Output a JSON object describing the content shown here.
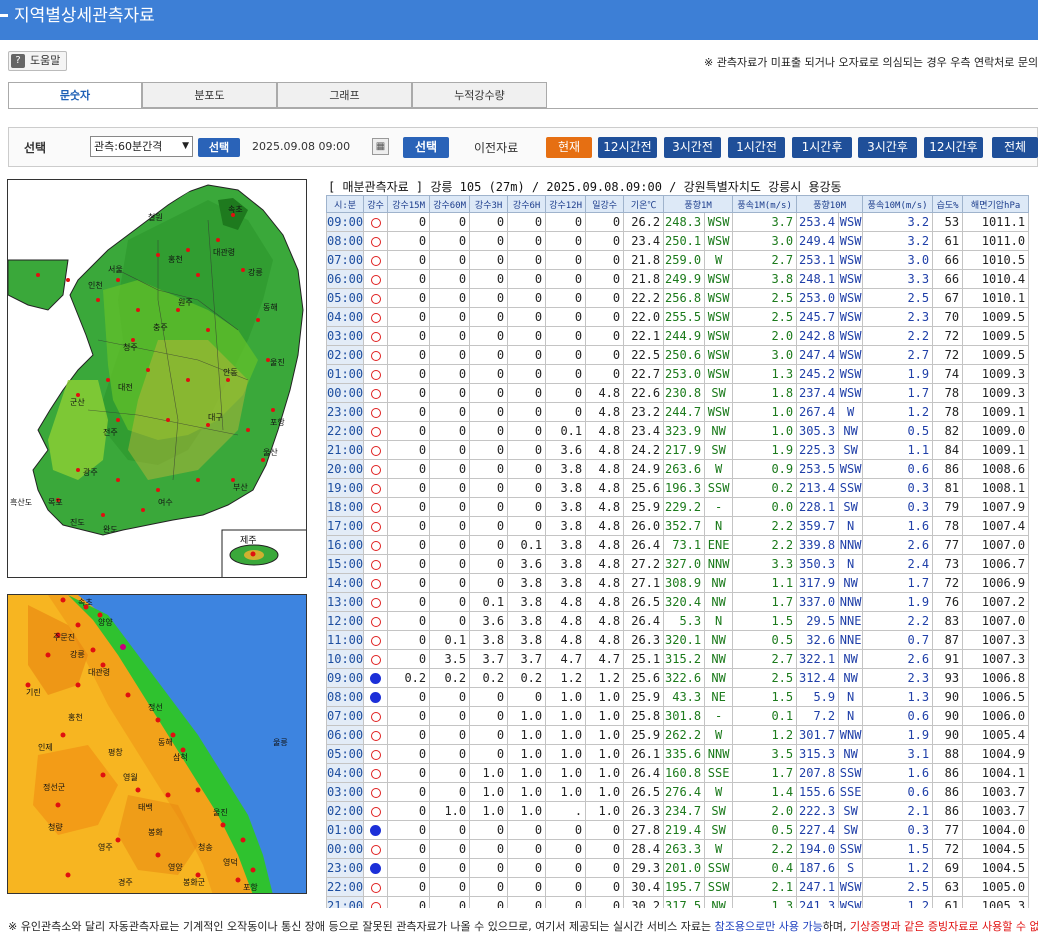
{
  "title": "지역별상세관측자료",
  "help_label": "도움말",
  "notice": "※ 관측자료가 미표출 되거나 오자료로 의심되는 경우 우측 연락처로 문의",
  "tabs": [
    "문숫자",
    "분포도",
    "그래프",
    "누적강수량"
  ],
  "selector": {
    "label": "선택",
    "interval": "관측:60분간격",
    "select_btn": "선택",
    "datetime": "2025.09.08 09:00",
    "select_btn2": "선택",
    "prev_label": "이전자료",
    "nav": [
      "현재",
      "12시간전",
      "3시간전",
      "1시간전",
      "1시간후",
      "3시간후",
      "12시간후",
      "전체"
    ]
  },
  "heading": "[ 매분관측자료 ] 강릉 105 (27m) / 2025.09.08.09:00 / 강원특별자치도 강릉시 용강동",
  "columns": [
    "시:분",
    "강수",
    "강수15M",
    "강수60M",
    "강수3H",
    "강수6H",
    "강수12H",
    "일강수",
    "기온℃",
    "풍향1M",
    "",
    "풍속1M(m/s)",
    "풍향10M",
    "",
    "풍속10M(m/s)",
    "습도%",
    "해면기압hPa"
  ],
  "rows": [
    [
      "09:00",
      "o",
      "0",
      "0",
      "0",
      "0",
      "0",
      "0",
      "26.2",
      "248.3",
      "WSW",
      "3.7",
      "253.4",
      "WSW",
      "3.2",
      "53",
      "1011.1"
    ],
    [
      "08:00",
      "o",
      "0",
      "0",
      "0",
      "0",
      "0",
      "0",
      "23.4",
      "250.1",
      "WSW",
      "3.0",
      "249.4",
      "WSW",
      "3.2",
      "61",
      "1011.0"
    ],
    [
      "07:00",
      "o",
      "0",
      "0",
      "0",
      "0",
      "0",
      "0",
      "21.8",
      "259.0",
      "W",
      "2.7",
      "253.1",
      "WSW",
      "3.0",
      "66",
      "1010.5"
    ],
    [
      "06:00",
      "o",
      "0",
      "0",
      "0",
      "0",
      "0",
      "0",
      "21.8",
      "249.9",
      "WSW",
      "3.8",
      "248.1",
      "WSW",
      "3.3",
      "66",
      "1010.4"
    ],
    [
      "05:00",
      "o",
      "0",
      "0",
      "0",
      "0",
      "0",
      "0",
      "22.2",
      "256.8",
      "WSW",
      "2.5",
      "253.0",
      "WSW",
      "2.5",
      "67",
      "1010.1"
    ],
    [
      "04:00",
      "o",
      "0",
      "0",
      "0",
      "0",
      "0",
      "0",
      "22.0",
      "255.5",
      "WSW",
      "2.5",
      "245.7",
      "WSW",
      "2.3",
      "70",
      "1009.5"
    ],
    [
      "03:00",
      "o",
      "0",
      "0",
      "0",
      "0",
      "0",
      "0",
      "22.1",
      "244.9",
      "WSW",
      "2.0",
      "242.8",
      "WSW",
      "2.2",
      "72",
      "1009.5"
    ],
    [
      "02:00",
      "o",
      "0",
      "0",
      "0",
      "0",
      "0",
      "0",
      "22.5",
      "250.6",
      "WSW",
      "3.0",
      "247.4",
      "WSW",
      "2.7",
      "72",
      "1009.5"
    ],
    [
      "01:00",
      "o",
      "0",
      "0",
      "0",
      "0",
      "0",
      "0",
      "22.7",
      "253.0",
      "WSW",
      "1.3",
      "245.2",
      "WSW",
      "1.9",
      "74",
      "1009.3"
    ],
    [
      "00:00",
      "o",
      "0",
      "0",
      "0",
      "0",
      "0",
      "4.8",
      "22.6",
      "230.8",
      "SW",
      "1.8",
      "237.4",
      "WSW",
      "1.7",
      "78",
      "1009.3"
    ],
    [
      "23:00",
      "o",
      "0",
      "0",
      "0",
      "0",
      "0",
      "4.8",
      "23.2",
      "244.7",
      "WSW",
      "1.0",
      "267.4",
      "W",
      "1.2",
      "78",
      "1009.1"
    ],
    [
      "22:00",
      "o",
      "0",
      "0",
      "0",
      "0",
      "0.1",
      "4.8",
      "23.4",
      "323.9",
      "NW",
      "1.0",
      "305.3",
      "NW",
      "0.5",
      "82",
      "1009.0"
    ],
    [
      "21:00",
      "o",
      "0",
      "0",
      "0",
      "0",
      "3.6",
      "4.8",
      "24.2",
      "217.9",
      "SW",
      "1.9",
      "225.3",
      "SW",
      "1.1",
      "84",
      "1009.1"
    ],
    [
      "20:00",
      "o",
      "0",
      "0",
      "0",
      "0",
      "3.8",
      "4.8",
      "24.9",
      "263.6",
      "W",
      "0.9",
      "253.5",
      "WSW",
      "0.6",
      "86",
      "1008.6"
    ],
    [
      "19:00",
      "o",
      "0",
      "0",
      "0",
      "0",
      "3.8",
      "4.8",
      "25.6",
      "196.3",
      "SSW",
      "0.2",
      "213.4",
      "SSW",
      "0.3",
      "81",
      "1008.1"
    ],
    [
      "18:00",
      "o",
      "0",
      "0",
      "0",
      "0",
      "3.8",
      "4.8",
      "25.9",
      "229.2",
      "-",
      "0.0",
      "228.1",
      "SW",
      "0.3",
      "79",
      "1007.9"
    ],
    [
      "17:00",
      "o",
      "0",
      "0",
      "0",
      "0",
      "3.8",
      "4.8",
      "26.0",
      "352.7",
      "N",
      "2.2",
      "359.7",
      "N",
      "1.6",
      "78",
      "1007.4"
    ],
    [
      "16:00",
      "o",
      "0",
      "0",
      "0",
      "0.1",
      "3.8",
      "4.8",
      "26.4",
      "73.1",
      "ENE",
      "2.2",
      "339.8",
      "NNW",
      "2.6",
      "77",
      "1007.0"
    ],
    [
      "15:00",
      "o",
      "0",
      "0",
      "0",
      "3.6",
      "3.8",
      "4.8",
      "27.2",
      "327.0",
      "NNW",
      "3.3",
      "350.3",
      "N",
      "2.4",
      "73",
      "1006.7"
    ],
    [
      "14:00",
      "o",
      "0",
      "0",
      "0",
      "3.8",
      "3.8",
      "4.8",
      "27.1",
      "308.9",
      "NW",
      "1.1",
      "317.9",
      "NW",
      "1.7",
      "72",
      "1006.9"
    ],
    [
      "13:00",
      "o",
      "0",
      "0",
      "0.1",
      "3.8",
      "4.8",
      "4.8",
      "26.5",
      "320.4",
      "NW",
      "1.7",
      "337.0",
      "NNW",
      "1.9",
      "76",
      "1007.2"
    ],
    [
      "12:00",
      "o",
      "0",
      "0",
      "3.6",
      "3.8",
      "4.8",
      "4.8",
      "26.4",
      "5.3",
      "N",
      "1.5",
      "29.5",
      "NNE",
      "2.2",
      "83",
      "1007.0"
    ],
    [
      "11:00",
      "o",
      "0",
      "0.1",
      "3.8",
      "3.8",
      "4.8",
      "4.8",
      "26.3",
      "320.1",
      "NW",
      "0.5",
      "32.6",
      "NNE",
      "0.7",
      "87",
      "1007.3"
    ],
    [
      "10:00",
      "o",
      "0",
      "3.5",
      "3.7",
      "3.7",
      "4.7",
      "4.7",
      "25.1",
      "315.2",
      "NW",
      "2.7",
      "322.1",
      "NW",
      "2.6",
      "91",
      "1007.3"
    ],
    [
      "09:00",
      "f",
      "0.2",
      "0.2",
      "0.2",
      "0.2",
      "1.2",
      "1.2",
      "25.6",
      "322.6",
      "NW",
      "2.5",
      "312.4",
      "NW",
      "2.3",
      "93",
      "1006.8"
    ],
    [
      "08:00",
      "f",
      "0",
      "0",
      "0",
      "0",
      "1.0",
      "1.0",
      "25.9",
      "43.3",
      "NE",
      "1.5",
      "5.9",
      "N",
      "1.3",
      "90",
      "1006.5"
    ],
    [
      "07:00",
      "o",
      "0",
      "0",
      "0",
      "1.0",
      "1.0",
      "1.0",
      "25.8",
      "301.8",
      "-",
      "0.1",
      "7.2",
      "N",
      "0.6",
      "90",
      "1006.0"
    ],
    [
      "06:00",
      "o",
      "0",
      "0",
      "0",
      "1.0",
      "1.0",
      "1.0",
      "25.9",
      "262.2",
      "W",
      "1.2",
      "301.7",
      "WNW",
      "1.9",
      "90",
      "1005.4"
    ],
    [
      "05:00",
      "o",
      "0",
      "0",
      "0",
      "1.0",
      "1.0",
      "1.0",
      "26.1",
      "335.6",
      "NNW",
      "3.5",
      "315.3",
      "NW",
      "3.1",
      "88",
      "1004.9"
    ],
    [
      "04:00",
      "o",
      "0",
      "0",
      "1.0",
      "1.0",
      "1.0",
      "1.0",
      "26.4",
      "160.8",
      "SSE",
      "1.7",
      "207.8",
      "SSW",
      "1.6",
      "86",
      "1004.1"
    ],
    [
      "03:00",
      "o",
      "0",
      "0",
      "1.0",
      "1.0",
      "1.0",
      "1.0",
      "26.5",
      "276.4",
      "W",
      "1.4",
      "155.6",
      "SSE",
      "0.6",
      "86",
      "1003.7"
    ],
    [
      "02:00",
      "o",
      "0",
      "1.0",
      "1.0",
      "1.0",
      ".",
      "1.0",
      "26.3",
      "234.7",
      "SW",
      "2.0",
      "222.3",
      "SW",
      "2.1",
      "86",
      "1003.7"
    ],
    [
      "01:00",
      "f",
      "0",
      "0",
      "0",
      "0",
      "0",
      "0",
      "27.8",
      "219.4",
      "SW",
      "0.5",
      "227.4",
      "SW",
      "0.3",
      "77",
      "1004.0"
    ],
    [
      "00:00",
      "o",
      "0",
      "0",
      "0",
      "0",
      "0",
      "0",
      "28.4",
      "263.3",
      "W",
      "2.2",
      "194.0",
      "SSW",
      "1.5",
      "72",
      "1004.5"
    ],
    [
      "23:00",
      "f",
      "0",
      "0",
      "0",
      "0",
      "0",
      "0",
      "29.3",
      "201.0",
      "SSW",
      "0.4",
      "187.6",
      "S",
      "1.2",
      "69",
      "1004.5"
    ],
    [
      "22:00",
      "o",
      "0",
      "0",
      "0",
      "0",
      "0",
      "0",
      "30.4",
      "195.7",
      "SSW",
      "2.1",
      "247.1",
      "WSW",
      "2.5",
      "63",
      "1005.0"
    ],
    [
      "21:00",
      "o",
      "0",
      "0",
      "0",
      "0",
      "0",
      "0",
      "30.2",
      "317.5",
      "NW",
      "1.3",
      "241.3",
      "WSW",
      "1.2",
      "61",
      "1005.3"
    ]
  ],
  "map1": {
    "inset_label": "제주",
    "labels": [
      "속초",
      "철원",
      "대관령",
      "강릉",
      "인천",
      "서울",
      "홍천",
      "원주",
      "동해",
      "울진",
      "충주",
      "청주",
      "안동",
      "대전",
      "포항",
      "군산",
      "전주",
      "대구",
      "울산",
      "광주",
      "부산",
      "목포",
      "여수",
      "흑산도",
      "진도",
      "완도"
    ]
  },
  "map2": {
    "labels": [
      "속초",
      "양양",
      "주문진",
      "강릉",
      "대관령",
      "정선",
      "동해",
      "삼척",
      "기린",
      "인제",
      "홍천",
      "평창",
      "영월",
      "태백",
      "울진",
      "봉화",
      "영주",
      "영양",
      "청송",
      "영덕",
      "포항",
      "경주",
      "울릉",
      "정선군",
      "청량",
      "봉화군"
    ]
  },
  "footer": {
    "main": "※ 유인관측소와 달리 자동관측자료는 기계적인 오작동이나 통신 장애 등으로 잘못된 관측자료가 나올 수 있으므로, 여기서 제공되는 실시간 서비스 자료는",
    "blue": "참조용으로만 사용 가능",
    "mid": "하며,",
    "red": "기상증명과 같은 증빙자료로 사용할 수 없습니다"
  },
  "colors": {
    "title_bar": "#3d7fd6",
    "current_btn": "#e66f12",
    "nav_btn": "#1f4f99",
    "rain_marker": "#1c2fd8",
    "dry_marker": "#e02020"
  }
}
